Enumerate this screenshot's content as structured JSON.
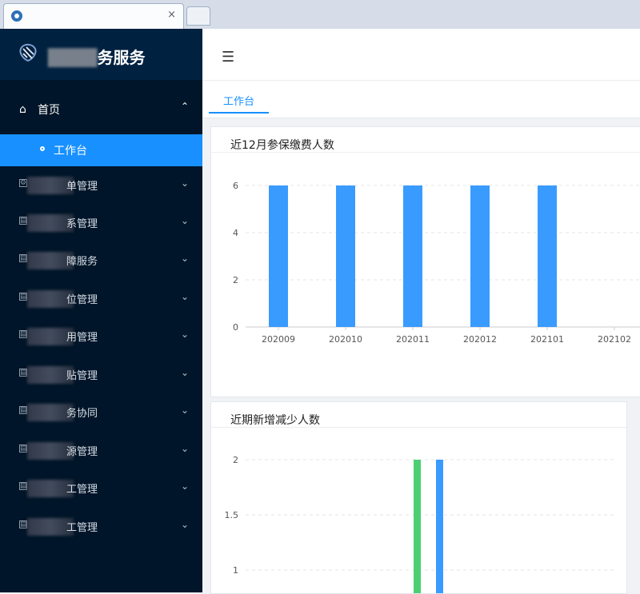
{
  "browser": {
    "tab_title": "",
    "close_symbol": "×"
  },
  "sidebar": {
    "logo_text_visible": "务服务",
    "home": {
      "label": "首页"
    },
    "workbench": {
      "label": "工作台"
    },
    "items": [
      {
        "label": "单管理"
      },
      {
        "label": "系管理"
      },
      {
        "label": "障服务"
      },
      {
        "label": "位管理"
      },
      {
        "label": "用管理"
      },
      {
        "label": "贴管理"
      },
      {
        "label": "务协同"
      },
      {
        "label": "源管理"
      },
      {
        "label": "工管理"
      },
      {
        "label": "工管理"
      }
    ]
  },
  "page_tabs": [
    {
      "label": "工作台"
    }
  ],
  "cards": {
    "top_title": "近12月参保缴费人数",
    "bottom_title": "近期新增减少人数"
  },
  "chart_data": [
    {
      "type": "bar",
      "title": "近12月参保缴费人数",
      "categories": [
        "202009",
        "202010",
        "202011",
        "202012",
        "202101",
        "202102"
      ],
      "values": [
        6,
        6,
        6,
        6,
        6,
        0
      ],
      "ylim": [
        0,
        6
      ],
      "yticks": [
        0,
        2,
        4,
        6
      ],
      "grid": "dashed-horizontal",
      "color": "#3a9bff"
    },
    {
      "type": "bar",
      "title": "近期新增减少人数",
      "yticks": [
        1,
        1.5,
        2
      ],
      "ylim": [
        1,
        2
      ],
      "series": [
        {
          "values": [
            2
          ],
          "color": "#4ccf73"
        },
        {
          "values": [
            2
          ],
          "color": "#3a9bff"
        }
      ],
      "grid": "dashed-horizontal"
    }
  ]
}
